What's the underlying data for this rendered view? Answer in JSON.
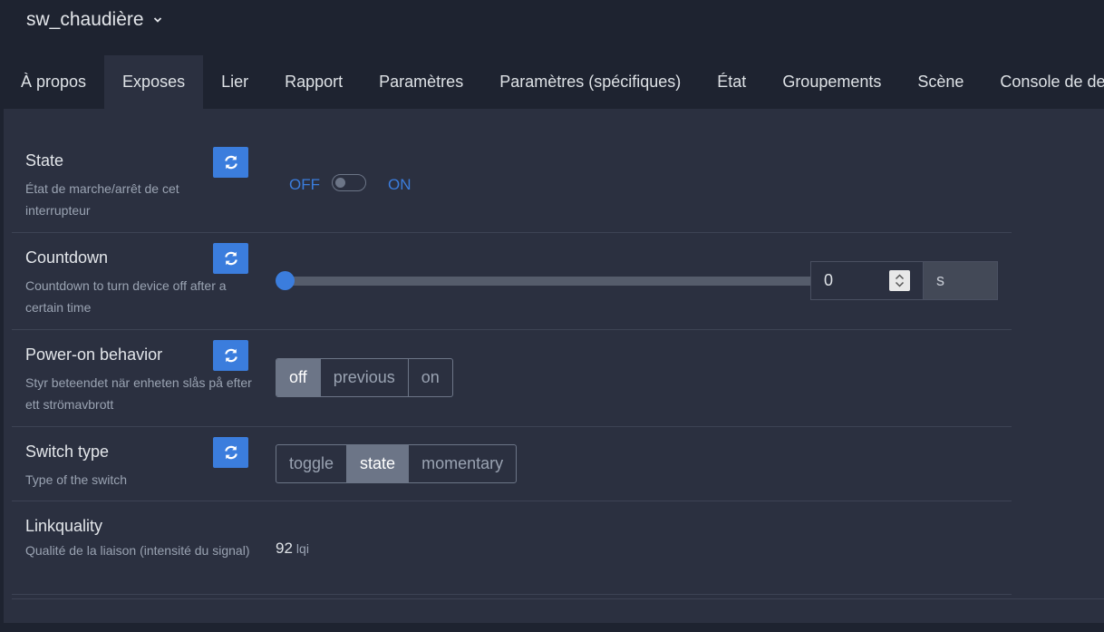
{
  "header": {
    "device_name": "sw_chaudière"
  },
  "tabs": [
    {
      "label": "À propos"
    },
    {
      "label": "Exposes"
    },
    {
      "label": "Lier"
    },
    {
      "label": "Rapport"
    },
    {
      "label": "Paramètres"
    },
    {
      "label": "Paramètres (spécifiques)"
    },
    {
      "label": "État"
    },
    {
      "label": "Groupements"
    },
    {
      "label": "Scène"
    },
    {
      "label": "Console de dev"
    }
  ],
  "active_tab": "Exposes",
  "exposes": {
    "state": {
      "label": "State",
      "description": "État de marche/arrêt de cet interrupteur",
      "off_label": "OFF",
      "on_label": "ON",
      "value": "OFF"
    },
    "countdown": {
      "label": "Countdown",
      "description": "Countdown to turn device off after a certain time",
      "value": "0",
      "unit": "s",
      "slider_fraction": 0
    },
    "power_on_behavior": {
      "label": "Power-on behavior",
      "description": "Styr beteendet när enheten slås på efter ett strömavbrott",
      "options": [
        "off",
        "previous",
        "on"
      ],
      "selected": "off"
    },
    "switch_type": {
      "label": "Switch type",
      "description": "Type of the switch",
      "options": [
        "toggle",
        "state",
        "momentary"
      ],
      "selected": "state"
    },
    "linkquality": {
      "label": "Linkquality",
      "description": "Qualité de la liaison (intensité du signal)",
      "value": "92",
      "unit": "lqi"
    }
  },
  "colors": {
    "accent": "#3b7ddd",
    "background": "#1e2330",
    "panel": "#2b3040",
    "selected_option": "#6c7587"
  },
  "icons": {
    "title_dropdown": "chevron-down-icon",
    "refresh": "refresh-icon"
  }
}
